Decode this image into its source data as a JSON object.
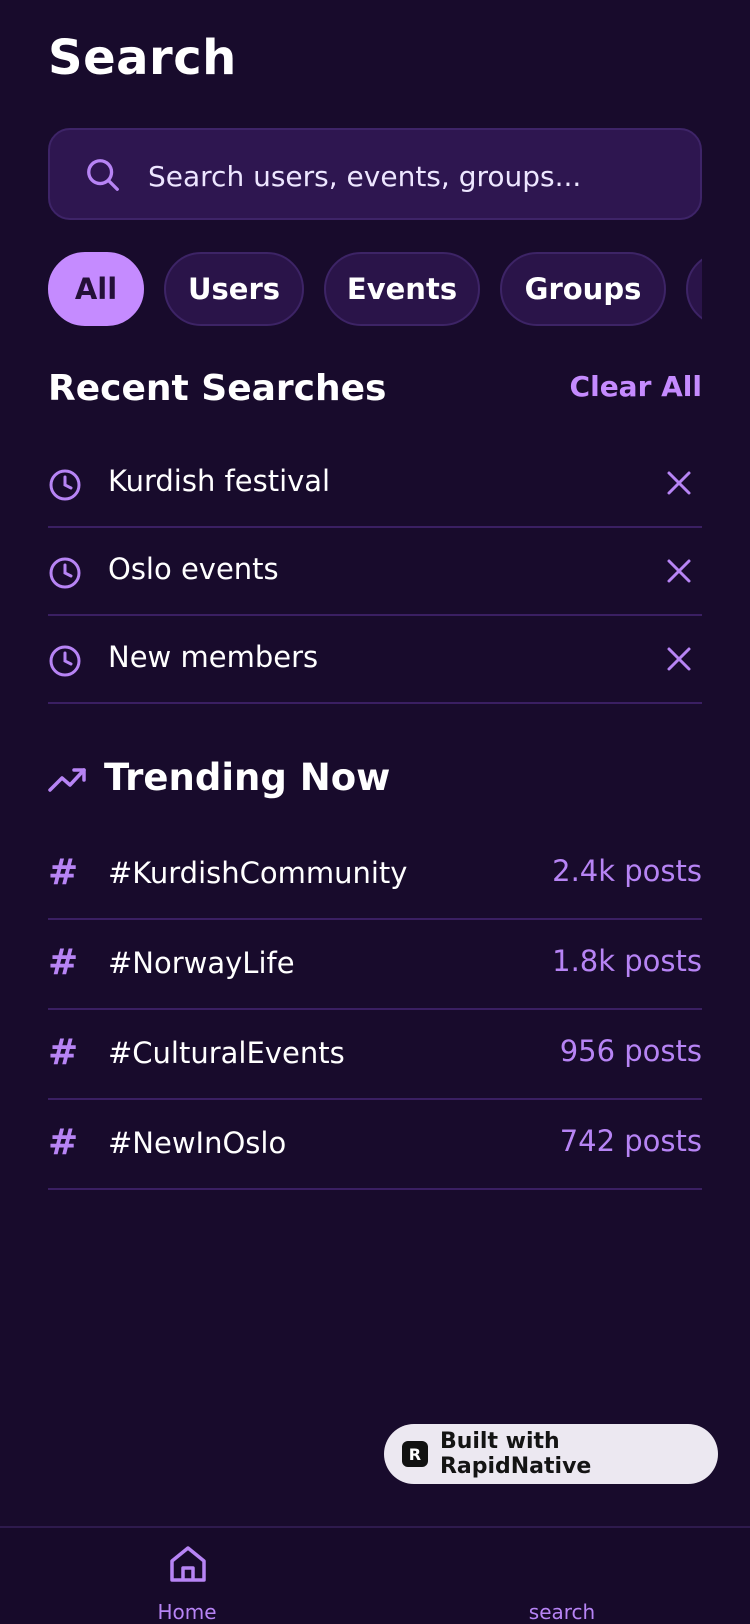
{
  "header": {
    "title": "Search"
  },
  "search": {
    "placeholder": "Search users, events, groups...",
    "value": ""
  },
  "filters": [
    {
      "label": "All",
      "active": true
    },
    {
      "label": "Users",
      "active": false
    },
    {
      "label": "Events",
      "active": false
    },
    {
      "label": "Groups",
      "active": false
    },
    {
      "label": "",
      "active": false
    }
  ],
  "recent": {
    "title": "Recent Searches",
    "clear_label": "Clear All",
    "items": [
      {
        "text": "Kurdish festival"
      },
      {
        "text": "Oslo events"
      },
      {
        "text": "New members"
      }
    ]
  },
  "trending": {
    "title": "Trending Now",
    "items": [
      {
        "tag": "#KurdishCommunity",
        "count": "2.4k posts"
      },
      {
        "tag": "#NorwayLife",
        "count": "1.8k posts"
      },
      {
        "tag": "#CulturalEvents",
        "count": "956 posts"
      },
      {
        "tag": "#NewInOslo",
        "count": "742 posts"
      }
    ]
  },
  "badge": {
    "label": "Built with RapidNative",
    "icon": "rapidnative-logo-icon"
  },
  "bottom_nav": {
    "home_label": "Home",
    "search_label": "search"
  },
  "colors": {
    "background": "#180B2C",
    "accent": "#C58BFF",
    "muted_accent": "#B784F5"
  }
}
